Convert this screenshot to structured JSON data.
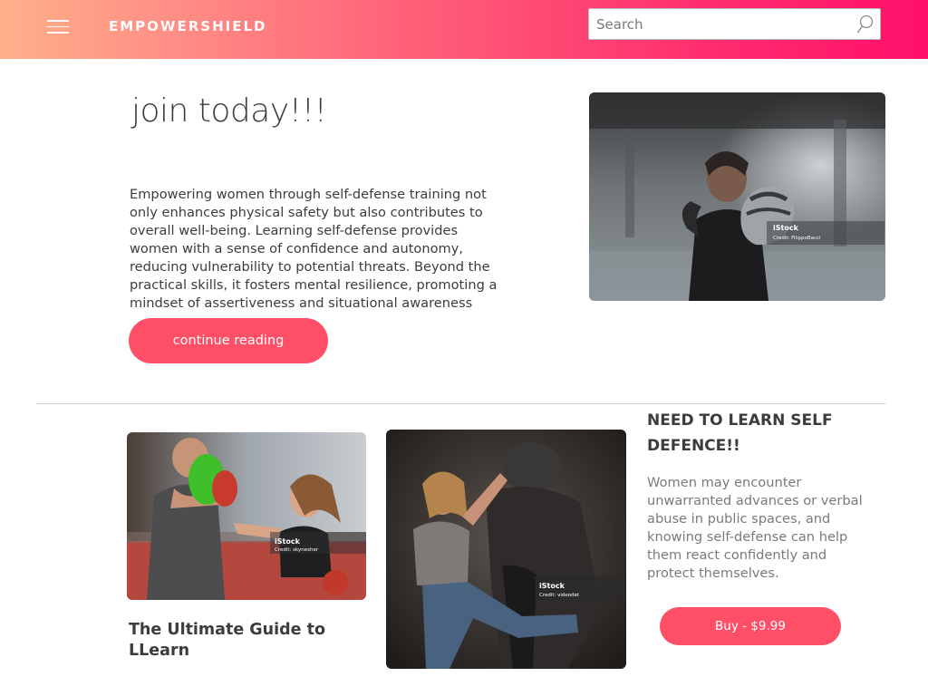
{
  "header": {
    "brand": "EMPOWERSHIELD",
    "menu_icon": "hamburger-menu-icon",
    "search": {
      "placeholder": "Search",
      "value": "",
      "icon": "search-icon"
    },
    "gradient_colors": [
      "#ffb08a",
      "#ff5f78",
      "#ff0f6a"
    ]
  },
  "hero": {
    "title": "join today!!!",
    "text": "Empowering women through self-defense training not only enhances physical safety but also contributes to overall well-being. Learning self-defense provides women with a sense of confidence and autonomy, reducing vulnerability to potential threats. Beyond the practical skills, it fosters mental resilience, promoting a mindset of assertiveness and situational awareness",
    "button_label": "continue reading",
    "image": {
      "stock_brand": "iStock",
      "credit": "Credit: FilippoBacci"
    }
  },
  "cards": [
    {
      "title": "The Ultimate Guide to LLearn",
      "image": {
        "stock_brand": "iStock",
        "credit": "Credit: skynesher"
      }
    },
    {
      "image": {
        "stock_brand": "iStock",
        "credit": "Credit: videodet"
      }
    }
  ],
  "sidebar": {
    "heading": "NEED TO LEARN SELF DEFENCE!!",
    "text": " Women may encounter unwarranted advances or verbal abuse in public spaces, and knowing self-defense can help them react confidently and protect themselves.",
    "button_label": "Buy - $9.99"
  },
  "colors": {
    "accent": "#ff4f66",
    "text": "#3c3c3c",
    "muted": "#7a7a7a"
  }
}
